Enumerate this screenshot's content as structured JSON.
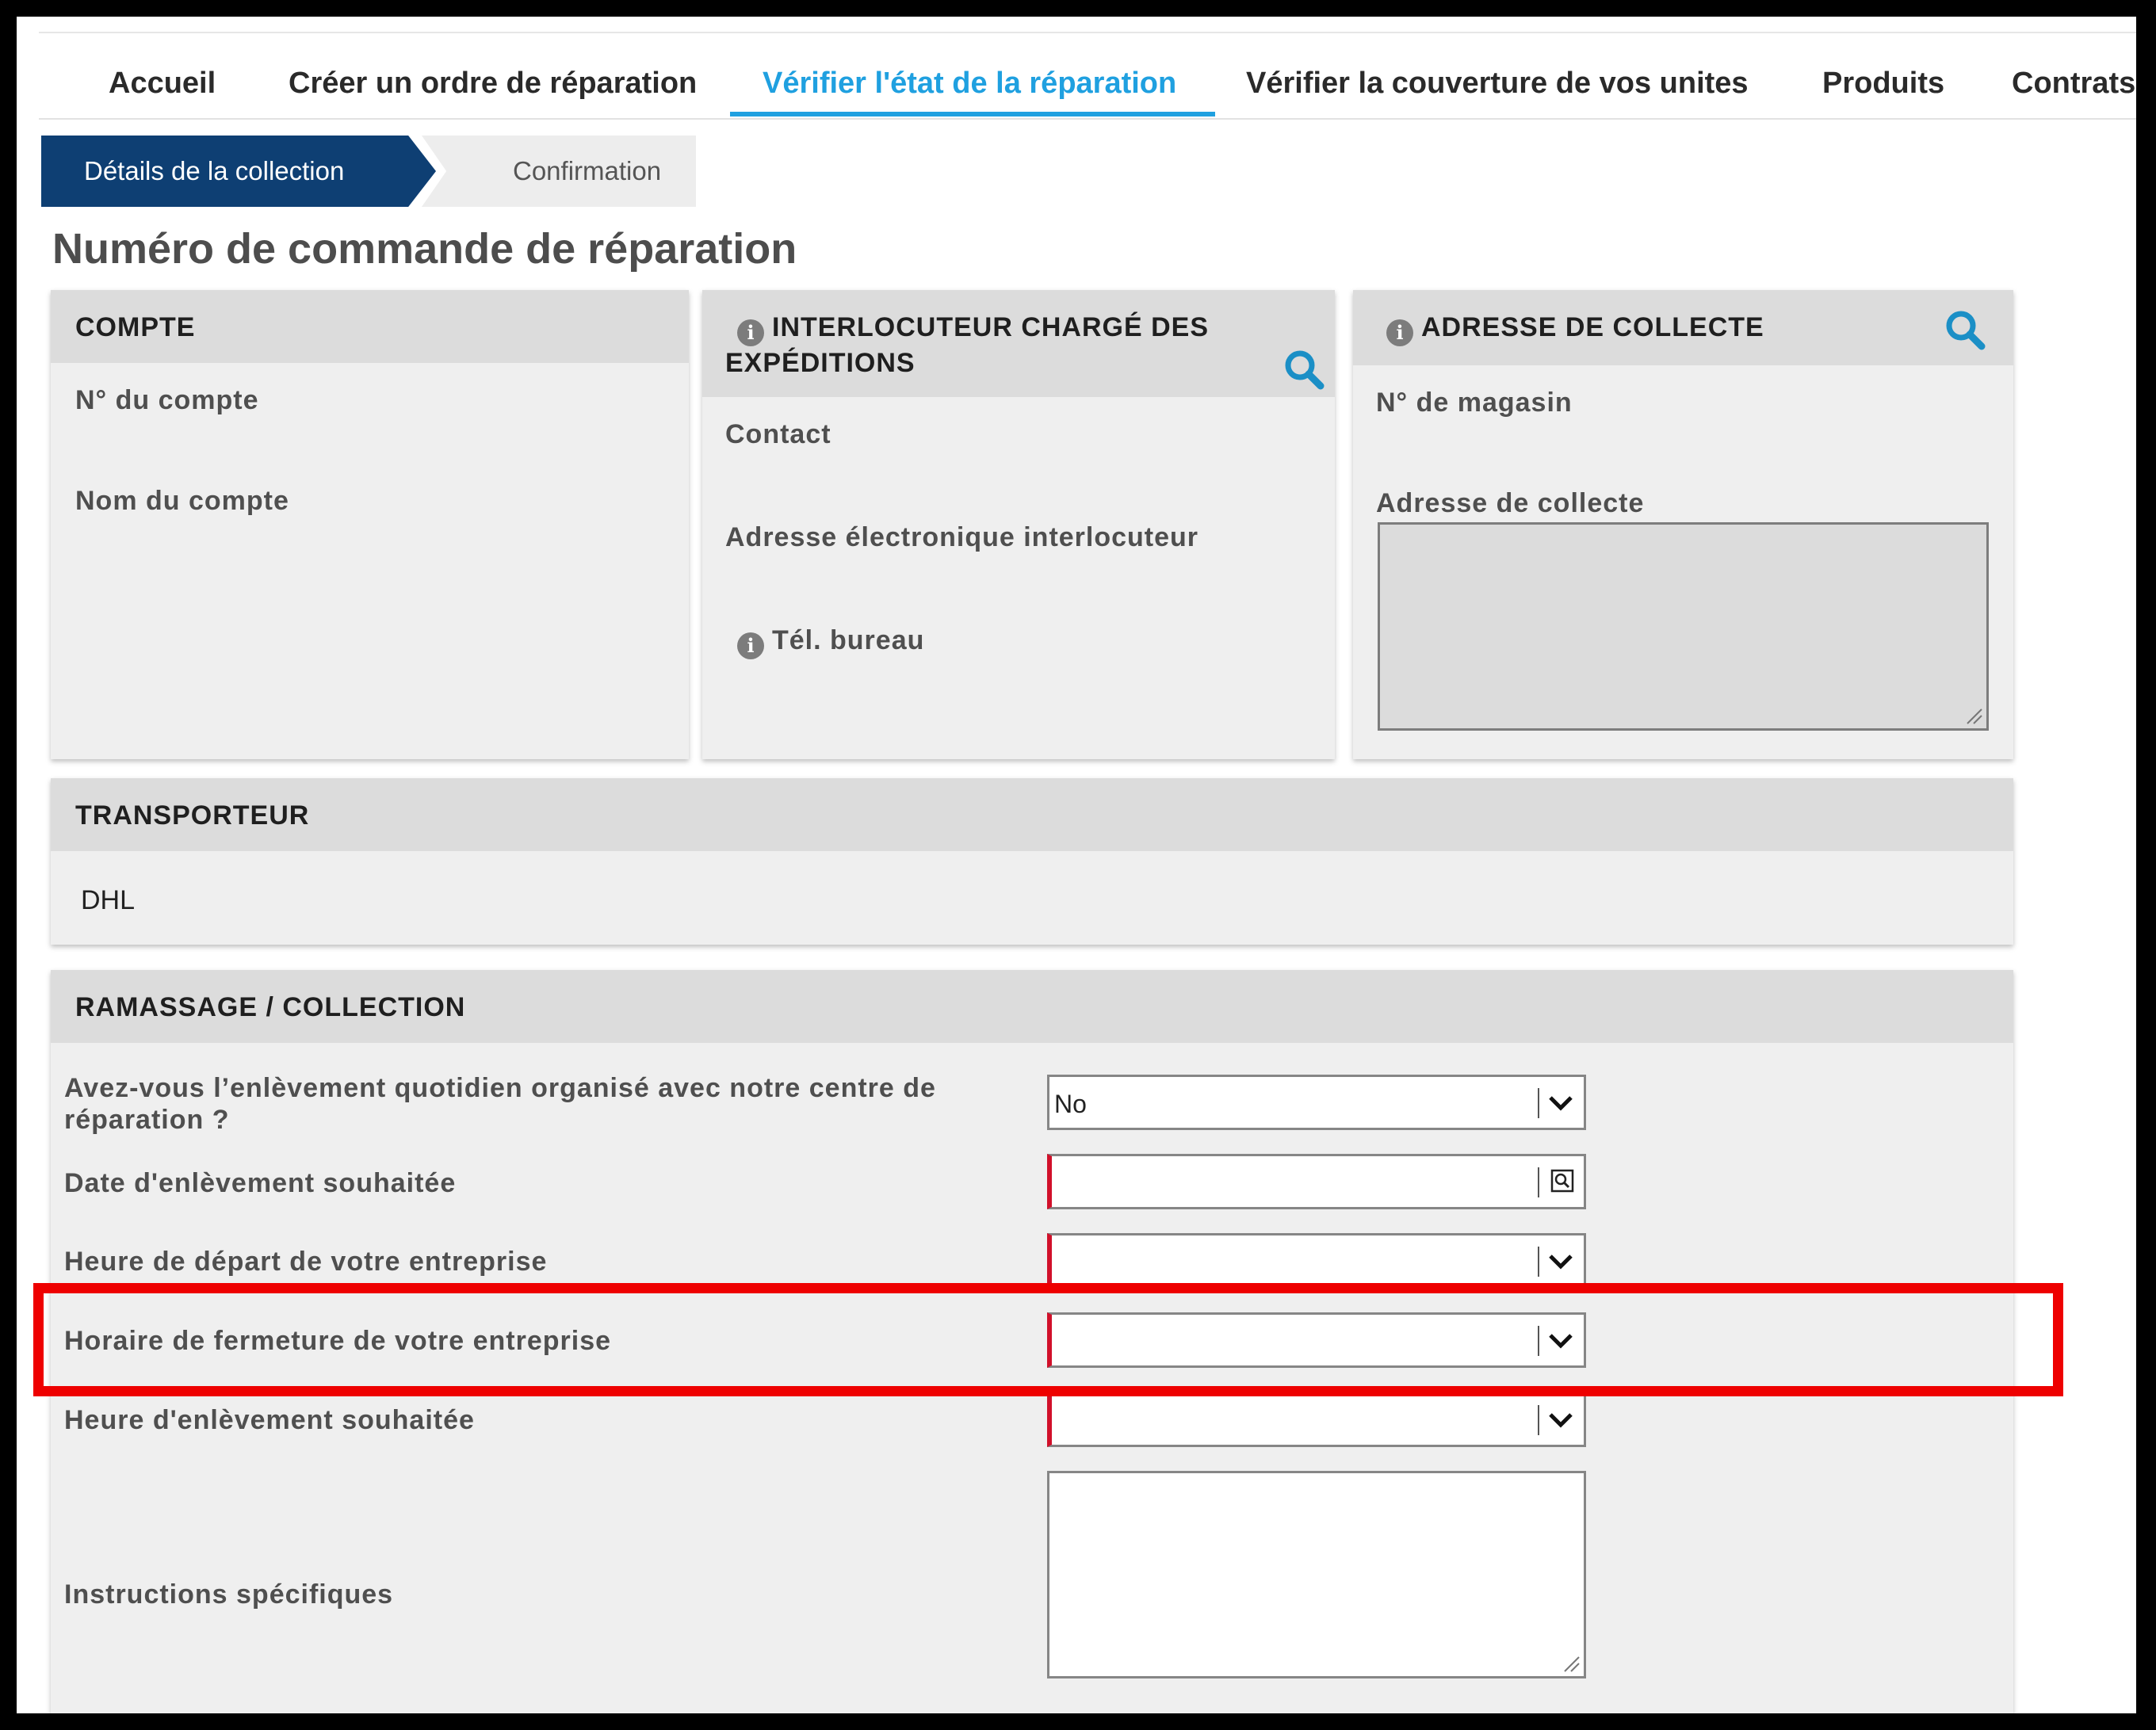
{
  "nav": {
    "items": [
      {
        "label": "Accueil"
      },
      {
        "label": "Créer un ordre de réparation"
      },
      {
        "label": "Vérifier l'état de la réparation"
      },
      {
        "label": "Vérifier la couverture de vos unites"
      },
      {
        "label": "Produits"
      },
      {
        "label": "Contrats"
      }
    ],
    "active_index": 2,
    "active_color": "#1fa0e0"
  },
  "steps": {
    "active": "Détails de la collection",
    "next": "Confirmation",
    "active_color": "#0e3f73"
  },
  "page_title": "Numéro de commande de réparation",
  "compte": {
    "title": "COMPTE",
    "account_number_label": "N° du compte",
    "account_name_label": "Nom du compte"
  },
  "interlocuteur": {
    "title": "INTERLOCUTEUR CHARGÉ DES EXPÉDITIONS",
    "title_line1": "INTERLOCUTEUR CHARGÉ DES",
    "title_line2": "EXPÉDITIONS",
    "contact_label": "Contact",
    "email_label": "Adresse électronique interlocuteur",
    "phone_label": "Tél. bureau"
  },
  "adresse": {
    "title": "ADRESSE DE COLLECTE",
    "store_label": "N° de magasin",
    "address_label": "Adresse de collecte",
    "address_value": ""
  },
  "transporteur": {
    "title": "TRANSPORTEUR",
    "value": "DHL"
  },
  "ramassage": {
    "title": "RAMASSAGE / COLLECTION",
    "daily_pickup_label_line1": "Avez-vous l’enlèvement quotidien organisé avec notre centre de",
    "daily_pickup_label_line2": "réparation ?",
    "daily_pickup_value": "No",
    "pickup_date_label": "Date d'enlèvement souhaitée",
    "pickup_date_value": "",
    "departure_time_label": "Heure de départ de votre entreprise",
    "departure_time_value": "",
    "closing_time_label": "Horaire de fermeture de votre entreprise",
    "closing_time_value": "",
    "pickup_time_label": "Heure d'enlèvement souhaitée",
    "pickup_time_value": "",
    "instructions_label": "Instructions spécifiques",
    "instructions_value": ""
  },
  "colors": {
    "required_marker": "#d1102a",
    "highlight": "#ee0000",
    "panel_header": "#dcdcdc",
    "panel_body": "#efefef"
  },
  "icons": [
    "info-icon",
    "search-icon",
    "chevron-down-icon",
    "calendar-icon",
    "resize-grip-icon"
  ]
}
